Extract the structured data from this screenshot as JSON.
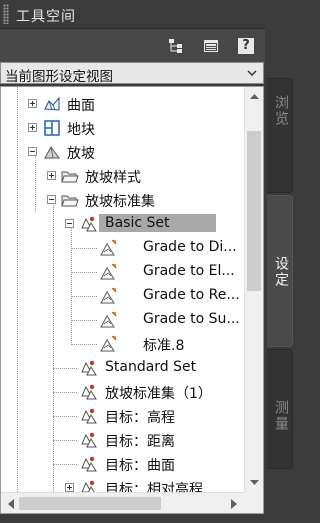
{
  "window": {
    "title": "工具空间"
  },
  "toolbar": {
    "buttons": [
      {
        "name": "tree-options-icon"
      },
      {
        "name": "item-view-icon"
      },
      {
        "name": "help-icon",
        "glyph": "?"
      }
    ]
  },
  "view_selector": {
    "value": "当前图形设定视图"
  },
  "tree": {
    "items": [
      {
        "label": "曲面",
        "icon": "surface-icon",
        "expander": "plus",
        "level": 1
      },
      {
        "label": "地块",
        "icon": "parcel-icon",
        "expander": "plus",
        "level": 1
      },
      {
        "label": "放坡",
        "icon": "grading-icon",
        "expander": "minus",
        "level": 1
      },
      {
        "label": "放坡样式",
        "icon": "folder-icon",
        "expander": "plus",
        "level": 2
      },
      {
        "label": "放坡标准集",
        "icon": "folder-icon",
        "expander": "minus",
        "level": 2
      },
      {
        "label": "Basic Set",
        "icon": "criteria-set-icon",
        "expander": "minus",
        "level": 3,
        "selected": true
      },
      {
        "label": "Grade to Di...",
        "icon": "criteria-icon",
        "expander": "none",
        "level": 4
      },
      {
        "label": "Grade to El...",
        "icon": "criteria-icon",
        "expander": "none",
        "level": 4
      },
      {
        "label": "Grade to Re...",
        "icon": "criteria-icon",
        "expander": "none",
        "level": 4
      },
      {
        "label": "Grade to Su...",
        "icon": "criteria-icon",
        "expander": "none",
        "level": 4
      },
      {
        "label": "标准.8",
        "icon": "criteria-icon",
        "expander": "none",
        "level": 4
      },
      {
        "label": "Standard Set",
        "icon": "criteria-set-icon",
        "expander": "none",
        "level": 3
      },
      {
        "label": "放坡标准集（1）",
        "icon": "criteria-set-icon",
        "expander": "none",
        "level": 3
      },
      {
        "label": "目标：高程",
        "icon": "criteria-set-icon",
        "expander": "none",
        "level": 3
      },
      {
        "label": "目标：距离",
        "icon": "criteria-set-icon",
        "expander": "none",
        "level": 3
      },
      {
        "label": "目标：曲面",
        "icon": "criteria-set-icon",
        "expander": "none",
        "level": 3
      },
      {
        "label": "目标：相对高程",
        "icon": "criteria-set-icon",
        "expander": "plus",
        "level": 3
      }
    ]
  },
  "side_tabs": [
    {
      "label": "浏览",
      "active": false
    },
    {
      "label": "设定",
      "active": true
    },
    {
      "label": "测量",
      "active": false
    }
  ],
  "colors": {
    "panel_bg": "#3b3b3b",
    "tree_bg": "#ffffff",
    "selection": "#a8a8a8",
    "tab_active_bg": "#4a4a4a",
    "tab_inactive_bg": "#333333"
  }
}
